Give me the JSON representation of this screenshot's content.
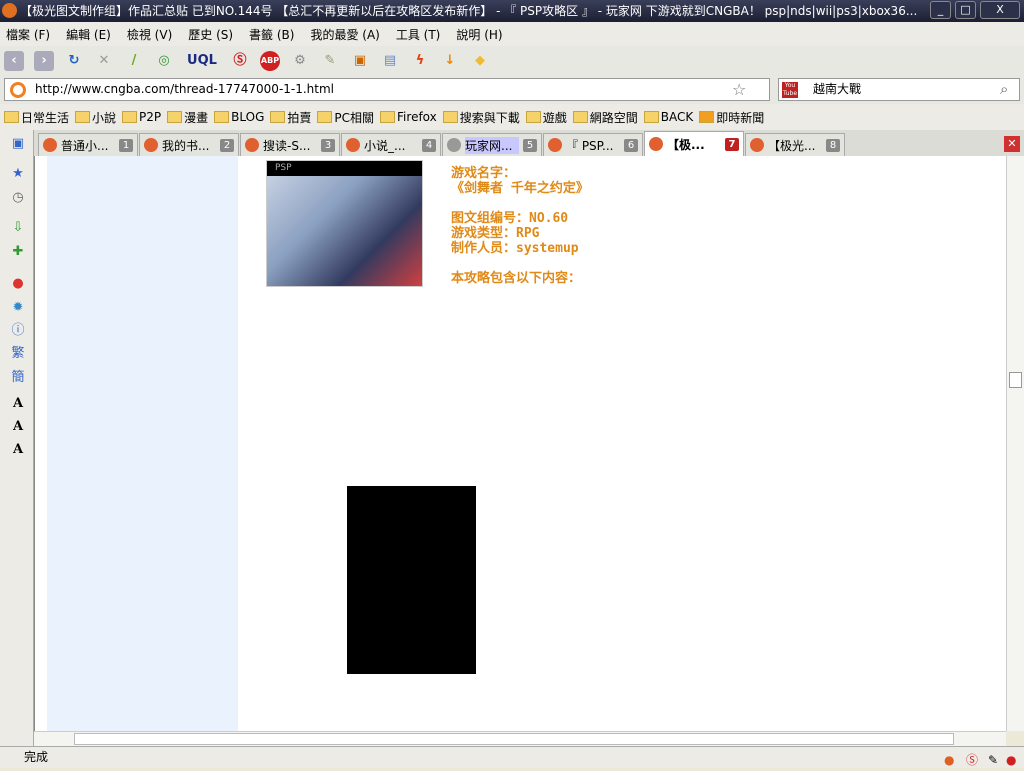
{
  "window": {
    "title": "【极光图文制作组】作品汇总贴 已到NO.144号 【总汇不再更新以后在攻略区发布新作】 - 『 PSP攻略区 』 - 玩家网 下游戏就到CNGBA！ psp|nds|wii|ps3|xbox36...",
    "minimize": "_",
    "maximize": "□",
    "close": "X"
  },
  "menu": [
    "檔案 (F)",
    "編輯 (E)",
    "檢視 (V)",
    "歷史 (S)",
    "書籤 (B)",
    "我的最愛 (A)",
    "工具 (T)",
    "說明 (H)"
  ],
  "address": {
    "url": "http://www.cngba.com/thread-17747000-1-1.html",
    "search": "越南大戰",
    "search_engine": "You Tube"
  },
  "bookmarks": [
    "日常生活",
    "小說",
    "P2P",
    "漫畫",
    "BLOG",
    "拍賣",
    "PC相關",
    "Firefox",
    "搜索與下載",
    "遊戲",
    "網路空間",
    "BACK",
    "即時新聞"
  ],
  "tabs": [
    {
      "label": "普通小...",
      "num": "1"
    },
    {
      "label": "我的书...",
      "num": "2"
    },
    {
      "label": "搜读-S...",
      "num": "3"
    },
    {
      "label": "小说_...",
      "num": "4"
    },
    {
      "label": "玩家网...",
      "num": "5"
    },
    {
      "label": "『 PSP...",
      "num": "6"
    },
    {
      "label": "【极...",
      "num": "7",
      "active": true
    },
    {
      "label": "【极光...",
      "num": "8"
    }
  ],
  "page": {
    "cover_brand": "PSP",
    "info": [
      "游戏名字：",
      "《剑舞者 千年之约定》",
      "",
      "图文组编号：NO.60",
      "游戏类型：RPG",
      "制作人员：systemup",
      "",
      "本攻略包含以下内容："
    ]
  },
  "status": "完成",
  "colors": {
    "info_text": "#e08a18",
    "left_pane": "#eaf2fd"
  }
}
